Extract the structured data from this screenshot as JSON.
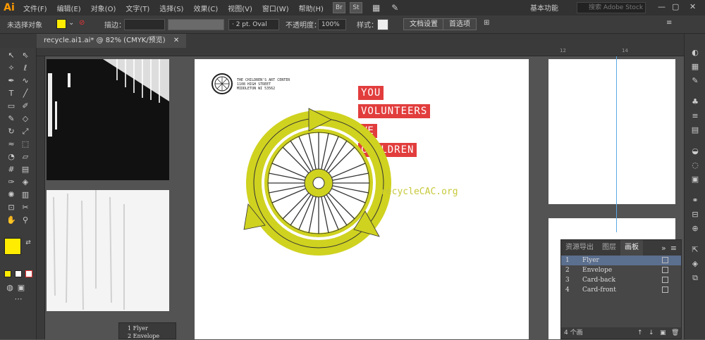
{
  "app": {
    "logo": "Ai"
  },
  "menu": [
    "文件(F)",
    "编辑(E)",
    "对象(O)",
    "文字(T)",
    "选择(S)",
    "效果(C)",
    "视图(V)",
    "窗口(W)",
    "帮助(H)"
  ],
  "bridge": [
    "Br",
    "St"
  ],
  "workspace": {
    "label": "基本功能",
    "search_placeholder": "搜索 Adobe Stock"
  },
  "control": {
    "selection_label": "未选择对象",
    "fill_color": "#ffec00",
    "stroke_label": "描边：",
    "brush_value": "· 2 pt. Oval",
    "opacity_label": "不透明度：",
    "opacity_value": "100%",
    "style_label": "样式：",
    "doc_setup": "文档设置",
    "preferences": "首选项"
  },
  "document": {
    "tab_title": "recycle.ai1.ai* @ 82% (CMYK/预览)"
  },
  "ruler_marks": [
    "12",
    "14"
  ],
  "flyer": {
    "org_lines": [
      "THE CHILDREN'S ART CENTER",
      "1108 HIGH STREET",
      "MIDDLETON WI 53562"
    ],
    "red_labels": [
      "YOU",
      "VOLUNTEERS",
      "WE",
      "CHILDREN"
    ],
    "url": "recycleCAC.org",
    "accent_red": "#e23d3d",
    "accent_green": "#cfd21f"
  },
  "artboards_panel": {
    "tabs": [
      "资源导出",
      "图层",
      "画板"
    ],
    "active_tab": "画板",
    "rows": [
      {
        "num": "1",
        "name": "Flyer"
      },
      {
        "num": "2",
        "name": "Envelope"
      },
      {
        "num": "3",
        "name": "Card-back"
      },
      {
        "num": "4",
        "name": "Card-front"
      }
    ],
    "footer": "4 个画"
  },
  "mini_list": [
    "1 Flyer",
    "2 Envelope"
  ]
}
